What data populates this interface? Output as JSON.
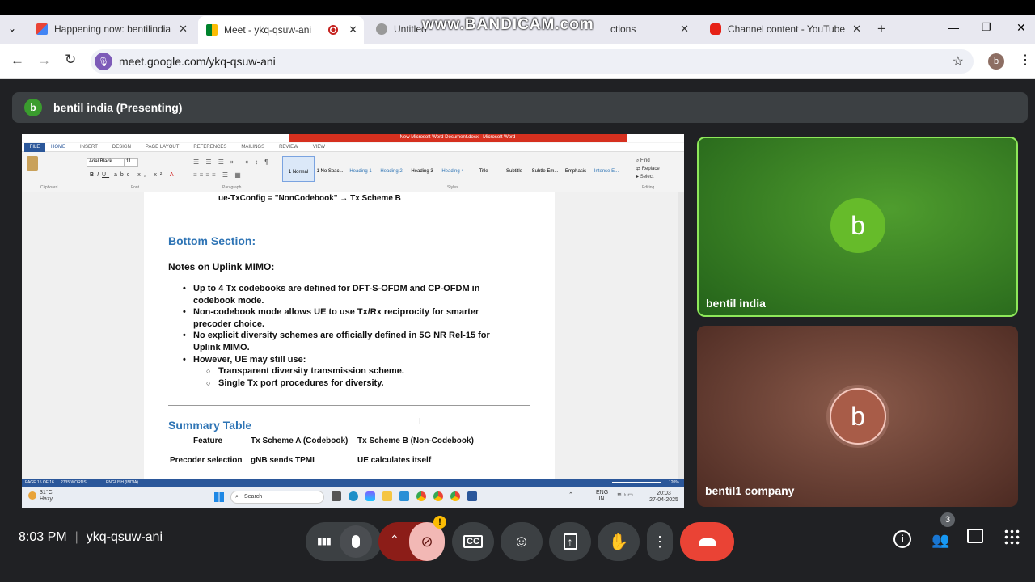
{
  "tabs": [
    {
      "title": "Happening now: bentilindia",
      "favicon": "gmail-icon"
    },
    {
      "title": "Meet - ykq-qsuw-ani",
      "favicon": "meet-icon",
      "recording": true
    },
    {
      "title": "Untitled",
      "favicon": "drive-icon"
    },
    {
      "title": "ctions",
      "favicon": "none"
    },
    {
      "title": "Channel content - YouTube",
      "favicon": "youtube-icon"
    }
  ],
  "watermark": "www.BANDICAM.com",
  "url": "meet.google.com/ykq-qsuw-ani",
  "profile_initial": "b",
  "presenter": {
    "initial": "b",
    "label": "bentil india (Presenting)"
  },
  "word": {
    "title": "New Microsoft Word Document.docx - Microsoft Word",
    "menu": [
      "FILE",
      "HOME",
      "INSERT",
      "DESIGN",
      "PAGE LAYOUT",
      "REFERENCES",
      "MAILINGS",
      "REVIEW",
      "VIEW"
    ],
    "font": "Arial Black",
    "size": "11",
    "styles": [
      "1 Normal",
      "1 No Spac...",
      "Heading 1",
      "Heading 2",
      "Heading 3",
      "Heading 4",
      "Title",
      "Subtitle",
      "Subtle Em...",
      "Emphasis",
      "Intense E..."
    ],
    "editing": [
      "Find",
      "Replace",
      "Select"
    ],
    "groups": [
      "Clipboard",
      "Font",
      "Paragraph",
      "Styles",
      "Editing"
    ],
    "status": {
      "page": "PAGE 15 OF 16",
      "words": "2735 WORDS",
      "lang": "ENGLISH (INDIA)",
      "zoom": "120%"
    }
  },
  "doc": {
    "top_line": "ue-TxConfig = \"NonCodebook\" → Tx Scheme B",
    "section_title": "Bottom Section:",
    "notes_heading": "Notes on Uplink MIMO:",
    "bullets": [
      "Up to 4 Tx codebooks are defined for DFT-S-OFDM and CP-OFDM in codebook mode.",
      "Non-codebook mode allows UE to use Tx/Rx reciprocity for smarter precoder choice.",
      "No explicit diversity schemes are officially defined in 5G NR Rel-15 for Uplink MIMO.",
      "However, UE may still use:"
    ],
    "sub_bullets": [
      "Transparent diversity transmission scheme.",
      "Single Tx port procedures for diversity."
    ],
    "table_title": "Summary Table",
    "table_header": [
      "Feature",
      "Tx Scheme A (Codebook)",
      "Tx Scheme B (Non-Codebook)"
    ],
    "table_row": [
      "Precoder selection",
      "gNB sends TPMI",
      "UE calculates itself"
    ]
  },
  "taskbar": {
    "weather_temp": "31°C",
    "weather_desc": "Hazy",
    "search": "Search",
    "lang": "ENG",
    "region": "IN",
    "time": "20:03",
    "date": "27-04-2025"
  },
  "tiles": [
    {
      "initial": "b",
      "name": "bentil india",
      "color": "#2f7d1e"
    },
    {
      "initial": "b",
      "name": "bentil1 company",
      "color": "#6b4034"
    }
  ],
  "meeting": {
    "time": "8:03 PM",
    "code": "ykq-qsuw-ani",
    "participants": "3"
  },
  "controls": [
    "audio-levels",
    "mic",
    "more-options-up",
    "camera-off",
    "captions",
    "emoji",
    "present",
    "raise-hand",
    "more",
    "leave-call"
  ]
}
